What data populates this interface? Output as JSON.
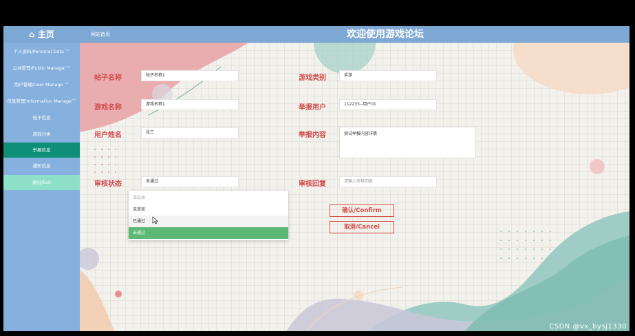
{
  "header": {
    "home_label": "⌂ 主页",
    "breadcrumb": "网站首页",
    "title": "欢迎使用游戏论坛"
  },
  "sidebar": {
    "items": [
      {
        "label": "个人资料/Personal Data  ﹀"
      },
      {
        "label": "公共管理/Public Manage  ﹀"
      },
      {
        "label": "用户管理/User Manage  ﹀"
      },
      {
        "label": "信息管理/Information Manage﹀"
      },
      {
        "label": "帖子信息"
      },
      {
        "label": "游戏分类"
      },
      {
        "label": "举报信息"
      },
      {
        "label": "通知信息"
      },
      {
        "label": "退出/Exit"
      }
    ],
    "active_index": 6
  },
  "form": {
    "post_name": {
      "label": "帖子名称",
      "value": "帖子名称1"
    },
    "game_category": {
      "label": "游戏类别",
      "value": "手游"
    },
    "game_name": {
      "label": "游戏名称",
      "value": "游戏名称1"
    },
    "report_user": {
      "label": "举报用户",
      "value": "112233--用户01"
    },
    "user_name": {
      "label": "用户姓名",
      "value": "张三"
    },
    "report_content": {
      "label": "举报内容",
      "value": "测试举报内容详情"
    },
    "review_status": {
      "label": "审核状态",
      "value": "未通过"
    },
    "review_reply": {
      "label": "审核回复",
      "placeholder": "请输入审核回复"
    }
  },
  "dropdown": {
    "options": [
      "请选择",
      "未审核",
      "已通过",
      "未通过"
    ],
    "selected": "未通过",
    "hovered": "已通过"
  },
  "buttons": {
    "confirm": "确认/Confirm",
    "cancel": "取消/Cancel"
  },
  "watermark": "CSDN @vx_bysj1330",
  "colors": {
    "topbar": "#7ea8d4",
    "sidebar": "#86b0de",
    "active_item": "#0f8f77",
    "exit_item": "#8fe0c8",
    "label_red": "#d14b4b",
    "selected_option": "#5cb874"
  }
}
